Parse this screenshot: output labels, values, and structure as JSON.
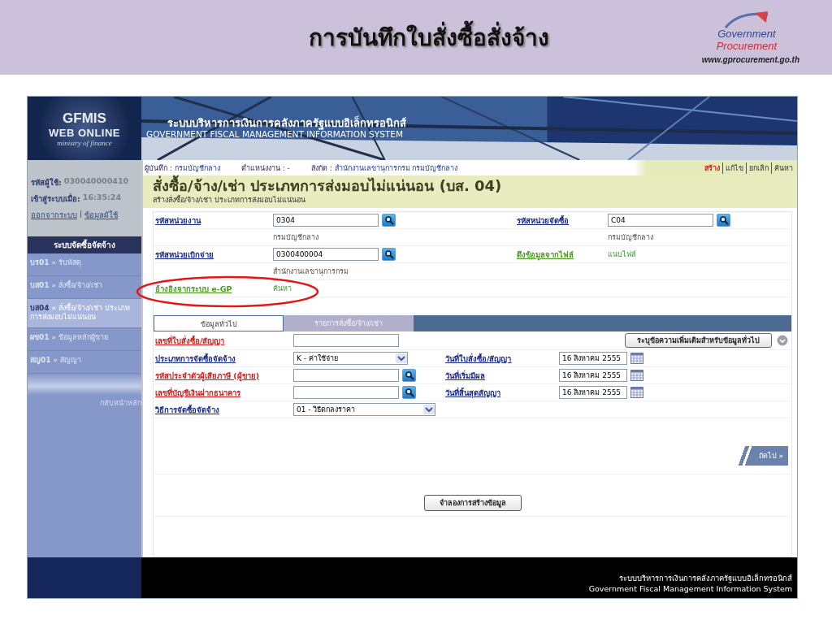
{
  "slide": {
    "title": "การบันทึกใบสั่งซื้อสั่งจ้าง",
    "logo_line_1": "Government",
    "logo_line_2": "Procurement",
    "url": "www.gprocurement.go.th"
  },
  "app": {
    "logo": {
      "line_1": "GFMIS",
      "line_2": "WEB ONLINE",
      "line_3": "ministry of finance"
    },
    "banner": {
      "thai": "ระบบบริหารการเงินการคลังภาครัฐแบบอิเล็กทรอนิกส์",
      "english": "GOVERNMENT FISCAL MANAGEMENT INFORMATION SYSTEM"
    },
    "user": {
      "id_label": "รหัสผู้ใช้:",
      "id": "030040000410",
      "login_label": "เข้าสู่ระบบเมื่อ:",
      "login_time": "16:35:24",
      "logout": "ออกจากระบบ",
      "divider": "|",
      "profile": "ข้อมูลผู้ใช้"
    },
    "menu": {
      "title": "ระบบจัดซื้อจัดจ้าง",
      "items": [
        {
          "code": "บร01",
          "label": "» รับพัสดุ",
          "selected": false
        },
        {
          "code": "บส01",
          "label": "» สั่งซื้อ/จ้าง/เช่า",
          "selected": false
        },
        {
          "code": "บส04",
          "label": "» สั่งซื้อ/จ้าง/เช่า ประเภทการส่งมอบไม่แน่นอน",
          "selected": true
        },
        {
          "code": "ผข01",
          "label": "» ข้อมูลหลักผู้ขาย",
          "selected": false
        },
        {
          "code": "สญ01",
          "label": "» สัญญา",
          "selected": false
        }
      ],
      "back": "กลับหน้าหลัก"
    },
    "info_bar": [
      {
        "label": "ผู้บันทึก :",
        "value": "กรมบัญชีกลาง"
      },
      {
        "label": "ตำแหน่งงาน :",
        "value": "-"
      },
      {
        "label": "สังกัด :",
        "value": "สำนักงานเลขานุการกรม กรมบัญชีกลาง"
      }
    ],
    "actions": [
      {
        "label": "สร้าง",
        "selected": true
      },
      {
        "label": "แก้ไข",
        "selected": false
      },
      {
        "label": "ยกเลิก",
        "selected": false
      },
      {
        "label": "ค้นหา",
        "selected": false
      }
    ],
    "page_title": "สั่งซื้อ/จ้าง/เช่า ประเภทการส่งมอบไม่แน่นอน (บส. 04)",
    "page_subtitle": "สร้างสั่งซื้อ/จ้าง/เช่า ประเภทการส่งมอบไม่แน่นอน",
    "header_rows": [
      {
        "cells": [
          {
            "kind": "lookup",
            "label": "รหัสหน่วยงาน",
            "value": "0304"
          },
          {
            "kind": "lookup",
            "label": "รหัสหน่วยจัดซื้อ",
            "value": "C04"
          }
        ]
      },
      {
        "cells": [
          {
            "kind": "note",
            "value": "กรมบัญชีกลาง"
          },
          {
            "kind": "note",
            "value": "กรมบัญชีกลาง"
          }
        ]
      },
      {
        "cells": [
          {
            "kind": "lookup",
            "label": "รหัสหน่วยเบิกจ่าย",
            "value": "0300400004"
          },
          {
            "kind": "link",
            "label": "ดึงข้อมูลจากไฟล์",
            "value": "แนบไฟล์"
          }
        ]
      },
      {
        "cells": [
          {
            "kind": "note",
            "value": "สำนักงานเลขานุการกรม"
          }
        ]
      },
      {
        "cells": [
          {
            "kind": "link",
            "label": "อ้างอิงจากระบบ e-GP",
            "value": "ค้นหา"
          }
        ]
      }
    ],
    "tabs": [
      {
        "label": "ข้อมูลทั่วไป",
        "selected": true
      },
      {
        "label": "รายการสั่งซื้อ/จ้าง/เช่า",
        "selected": false
      }
    ],
    "extra_button": "ระบุข้อความเพิ่มเติมสำหรับข้อมูลทั่วไป",
    "form_rows": [
      {
        "left": {
          "kind": "text",
          "label": "เลขที่ใบสั่งซื้อ/สัญญา",
          "required": true
        }
      },
      {
        "left": {
          "kind": "select",
          "label": "ประเภทการจัดซื้อจัดจ้าง",
          "required": false,
          "value": "K - ค่าใช้จ่าย"
        },
        "right": {
          "kind": "date",
          "label": "วันที่ใบสั่งซื้อ/สัญญา",
          "value": "16 สิงหาคม 2555"
        }
      },
      {
        "left": {
          "kind": "lookup",
          "label": "รหัสประจำตัวผู้เสียภาษี (ผู้ขาย)",
          "required": true
        },
        "right": {
          "kind": "date",
          "label": "วันที่เริ่มมีผล",
          "value": "16 สิงหาคม 2555"
        }
      },
      {
        "left": {
          "kind": "lookup",
          "label": "เลขที่บัญชีเงินฝากธนาคาร",
          "required": true
        },
        "right": {
          "kind": "date",
          "label": "วันที่สิ้นสุดสัญญา",
          "value": "16 สิงหาคม 2555"
        }
      },
      {
        "left": {
          "kind": "select",
          "label": "วิธีการจัดซื้อจัดจ้าง",
          "required": false,
          "value": "01 - วิธีตกลงราคา",
          "wide": true
        }
      }
    ],
    "next": "ถัดไป »",
    "simulate_button": "จำลองการสร้างข้อมูล",
    "footer": {
      "thai": "ระบบบริหารการเงินการคลังภาครัฐแบบอิเล็กทรอนิกส์",
      "english": "Government Fiscal Management Information System"
    }
  }
}
